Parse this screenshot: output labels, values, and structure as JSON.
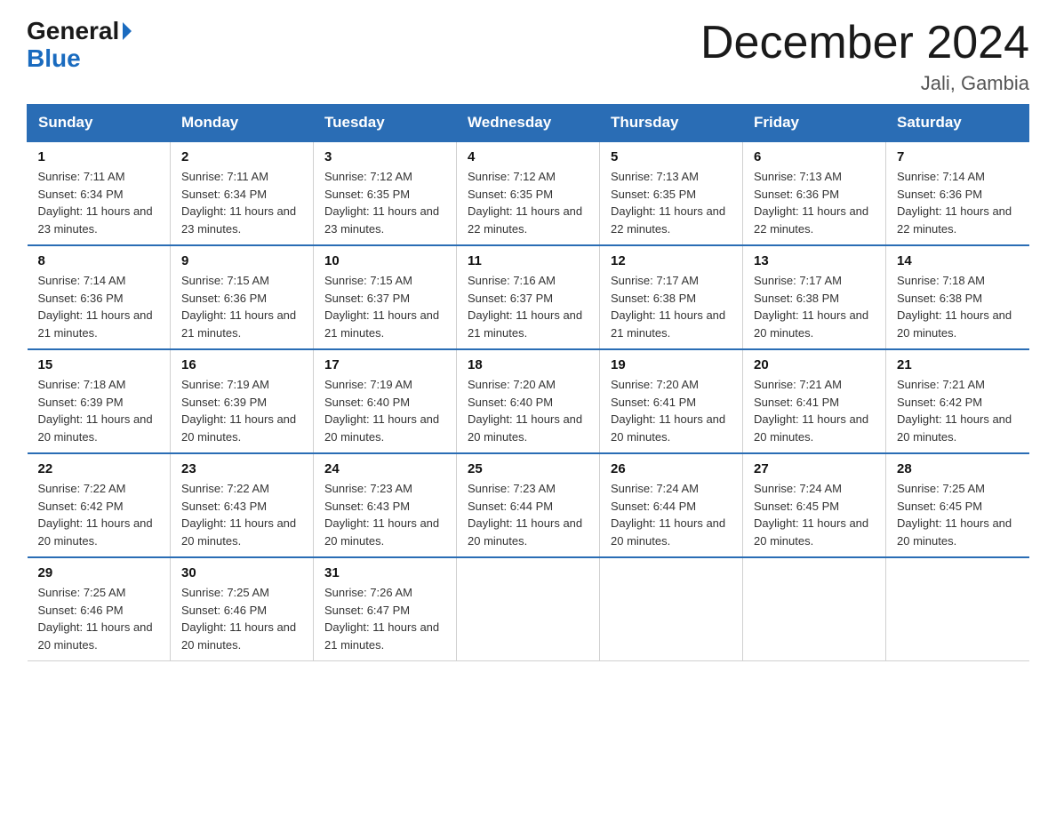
{
  "logo": {
    "general": "General",
    "blue": "Blue"
  },
  "header": {
    "month_year": "December 2024",
    "location": "Jali, Gambia"
  },
  "days_of_week": [
    "Sunday",
    "Monday",
    "Tuesday",
    "Wednesday",
    "Thursday",
    "Friday",
    "Saturday"
  ],
  "weeks": [
    [
      {
        "day": "1",
        "sunrise": "7:11 AM",
        "sunset": "6:34 PM",
        "daylight": "11 hours and 23 minutes."
      },
      {
        "day": "2",
        "sunrise": "7:11 AM",
        "sunset": "6:34 PM",
        "daylight": "11 hours and 23 minutes."
      },
      {
        "day": "3",
        "sunrise": "7:12 AM",
        "sunset": "6:35 PM",
        "daylight": "11 hours and 23 minutes."
      },
      {
        "day": "4",
        "sunrise": "7:12 AM",
        "sunset": "6:35 PM",
        "daylight": "11 hours and 22 minutes."
      },
      {
        "day": "5",
        "sunrise": "7:13 AM",
        "sunset": "6:35 PM",
        "daylight": "11 hours and 22 minutes."
      },
      {
        "day": "6",
        "sunrise": "7:13 AM",
        "sunset": "6:36 PM",
        "daylight": "11 hours and 22 minutes."
      },
      {
        "day": "7",
        "sunrise": "7:14 AM",
        "sunset": "6:36 PM",
        "daylight": "11 hours and 22 minutes."
      }
    ],
    [
      {
        "day": "8",
        "sunrise": "7:14 AM",
        "sunset": "6:36 PM",
        "daylight": "11 hours and 21 minutes."
      },
      {
        "day": "9",
        "sunrise": "7:15 AM",
        "sunset": "6:36 PM",
        "daylight": "11 hours and 21 minutes."
      },
      {
        "day": "10",
        "sunrise": "7:15 AM",
        "sunset": "6:37 PM",
        "daylight": "11 hours and 21 minutes."
      },
      {
        "day": "11",
        "sunrise": "7:16 AM",
        "sunset": "6:37 PM",
        "daylight": "11 hours and 21 minutes."
      },
      {
        "day": "12",
        "sunrise": "7:17 AM",
        "sunset": "6:38 PM",
        "daylight": "11 hours and 21 minutes."
      },
      {
        "day": "13",
        "sunrise": "7:17 AM",
        "sunset": "6:38 PM",
        "daylight": "11 hours and 20 minutes."
      },
      {
        "day": "14",
        "sunrise": "7:18 AM",
        "sunset": "6:38 PM",
        "daylight": "11 hours and 20 minutes."
      }
    ],
    [
      {
        "day": "15",
        "sunrise": "7:18 AM",
        "sunset": "6:39 PM",
        "daylight": "11 hours and 20 minutes."
      },
      {
        "day": "16",
        "sunrise": "7:19 AM",
        "sunset": "6:39 PM",
        "daylight": "11 hours and 20 minutes."
      },
      {
        "day": "17",
        "sunrise": "7:19 AM",
        "sunset": "6:40 PM",
        "daylight": "11 hours and 20 minutes."
      },
      {
        "day": "18",
        "sunrise": "7:20 AM",
        "sunset": "6:40 PM",
        "daylight": "11 hours and 20 minutes."
      },
      {
        "day": "19",
        "sunrise": "7:20 AM",
        "sunset": "6:41 PM",
        "daylight": "11 hours and 20 minutes."
      },
      {
        "day": "20",
        "sunrise": "7:21 AM",
        "sunset": "6:41 PM",
        "daylight": "11 hours and 20 minutes."
      },
      {
        "day": "21",
        "sunrise": "7:21 AM",
        "sunset": "6:42 PM",
        "daylight": "11 hours and 20 minutes."
      }
    ],
    [
      {
        "day": "22",
        "sunrise": "7:22 AM",
        "sunset": "6:42 PM",
        "daylight": "11 hours and 20 minutes."
      },
      {
        "day": "23",
        "sunrise": "7:22 AM",
        "sunset": "6:43 PM",
        "daylight": "11 hours and 20 minutes."
      },
      {
        "day": "24",
        "sunrise": "7:23 AM",
        "sunset": "6:43 PM",
        "daylight": "11 hours and 20 minutes."
      },
      {
        "day": "25",
        "sunrise": "7:23 AM",
        "sunset": "6:44 PM",
        "daylight": "11 hours and 20 minutes."
      },
      {
        "day": "26",
        "sunrise": "7:24 AM",
        "sunset": "6:44 PM",
        "daylight": "11 hours and 20 minutes."
      },
      {
        "day": "27",
        "sunrise": "7:24 AM",
        "sunset": "6:45 PM",
        "daylight": "11 hours and 20 minutes."
      },
      {
        "day": "28",
        "sunrise": "7:25 AM",
        "sunset": "6:45 PM",
        "daylight": "11 hours and 20 minutes."
      }
    ],
    [
      {
        "day": "29",
        "sunrise": "7:25 AM",
        "sunset": "6:46 PM",
        "daylight": "11 hours and 20 minutes."
      },
      {
        "day": "30",
        "sunrise": "7:25 AM",
        "sunset": "6:46 PM",
        "daylight": "11 hours and 20 minutes."
      },
      {
        "day": "31",
        "sunrise": "7:26 AM",
        "sunset": "6:47 PM",
        "daylight": "11 hours and 21 minutes."
      },
      null,
      null,
      null,
      null
    ]
  ],
  "labels": {
    "sunrise": "Sunrise: ",
    "sunset": "Sunset: ",
    "daylight": "Daylight: "
  }
}
